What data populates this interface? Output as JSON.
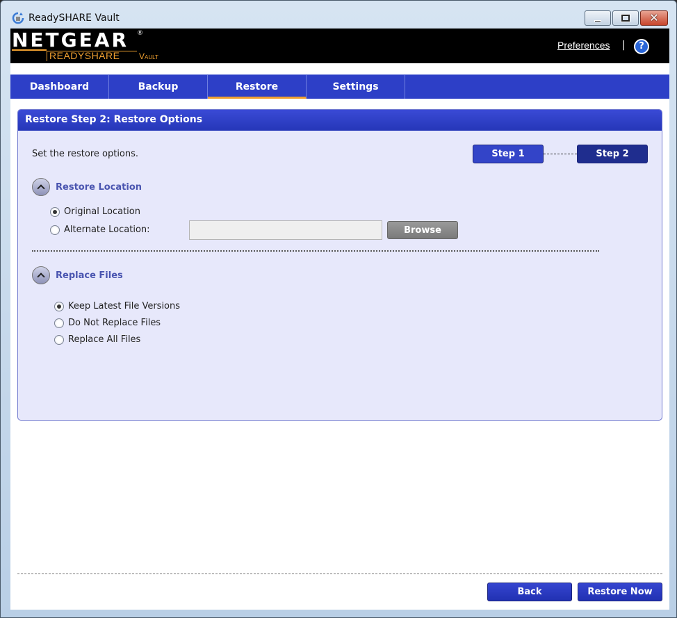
{
  "window": {
    "title": "ReadySHARE Vault"
  },
  "header": {
    "logo_main": "NETGEAR",
    "logo_reg": "®",
    "logo_sub": "READYSHARE",
    "logo_vault": "Vault",
    "preferences": "Preferences",
    "separator": "|",
    "help": "?"
  },
  "tabs": [
    {
      "label": "Dashboard"
    },
    {
      "label": "Backup"
    },
    {
      "label": "Restore",
      "active": true
    },
    {
      "label": "Settings"
    }
  ],
  "panel": {
    "title": "Restore Step 2: Restore Options",
    "intro": "Set the restore options.",
    "steps": [
      "Step 1",
      "Step 2"
    ],
    "restore_location": {
      "title": "Restore Location",
      "options": [
        {
          "label": "Original Location",
          "selected": true
        },
        {
          "label": "Alternate Location:",
          "selected": false
        }
      ],
      "path_value": "",
      "browse": "Browse"
    },
    "replace_files": {
      "title": "Replace Files",
      "options": [
        {
          "label": "Keep Latest File Versions",
          "selected": true
        },
        {
          "label": "Do Not Replace Files",
          "selected": false
        },
        {
          "label": "Replace All Files",
          "selected": false
        }
      ]
    }
  },
  "footer": {
    "back": "Back",
    "restore_now": "Restore Now"
  },
  "colors": {
    "tab_bar": "#2d3fc7",
    "accent": "#f0a030",
    "panel_bg": "#e7e8fb",
    "section_title": "#4a55b0"
  }
}
